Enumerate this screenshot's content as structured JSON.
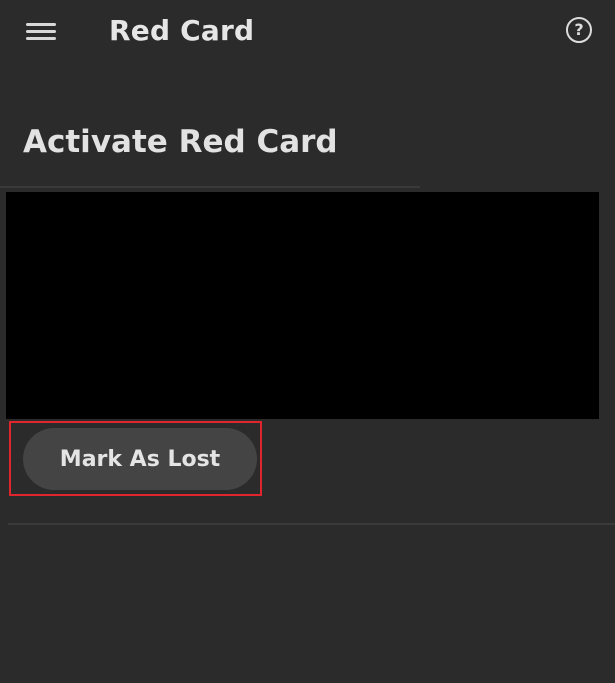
{
  "header": {
    "title": "Red Card",
    "menu_icon": "hamburger-menu-icon",
    "help_icon": "question-circle-icon",
    "help_glyph": "?"
  },
  "main": {
    "section_title": "Activate Red Card",
    "actions": {
      "mark_lost_label": "Mark As Lost"
    }
  },
  "colors": {
    "background": "#2b2b2b",
    "card_area": "#000000",
    "button": "#444444",
    "highlight": "#e0262c"
  }
}
